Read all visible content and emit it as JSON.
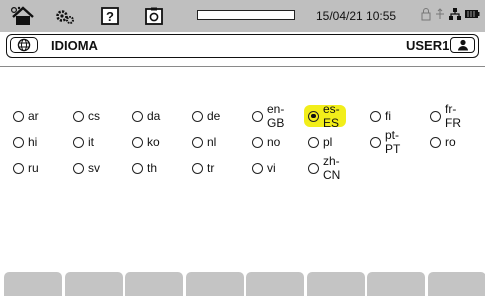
{
  "statusbar": {
    "icons": [
      "home-icon",
      "settings-icon",
      "help-icon",
      "camera-icon"
    ],
    "progress": 0,
    "datetime": "15/04/21 10:55",
    "system_icons": [
      "lock-icon",
      "transfer-icon",
      "network-icon",
      "battery-icon"
    ]
  },
  "titlebar": {
    "icon": "globe-icon",
    "title": "IDIOMA",
    "user": "USER1",
    "user_icon": "user-icon"
  },
  "languages": [
    {
      "code": "ar",
      "selected": false
    },
    {
      "code": "cs",
      "selected": false
    },
    {
      "code": "da",
      "selected": false
    },
    {
      "code": "de",
      "selected": false
    },
    {
      "code": "en-GB",
      "selected": false
    },
    {
      "code": "es-ES",
      "selected": true
    },
    {
      "code": "fi",
      "selected": false
    },
    {
      "code": "fr-FR",
      "selected": false
    },
    {
      "code": "hi",
      "selected": false
    },
    {
      "code": "it",
      "selected": false
    },
    {
      "code": "ko",
      "selected": false
    },
    {
      "code": "nl",
      "selected": false
    },
    {
      "code": "no",
      "selected": false
    },
    {
      "code": "pl",
      "selected": false
    },
    {
      "code": "pt-PT",
      "selected": false
    },
    {
      "code": "ro",
      "selected": false
    },
    {
      "code": "ru",
      "selected": false
    },
    {
      "code": "sv",
      "selected": false
    },
    {
      "code": "th",
      "selected": false
    },
    {
      "code": "tr",
      "selected": false
    },
    {
      "code": "vi",
      "selected": false
    },
    {
      "code": "zh-CN",
      "selected": false
    }
  ],
  "softkeys": [
    "",
    "",
    "",
    "",
    "",
    "",
    "",
    ""
  ],
  "colors": {
    "statusbar_bg": "#bfbfbf",
    "selection_highlight": "#f2ee1a",
    "softkey_bg": "#c4c4c4"
  }
}
